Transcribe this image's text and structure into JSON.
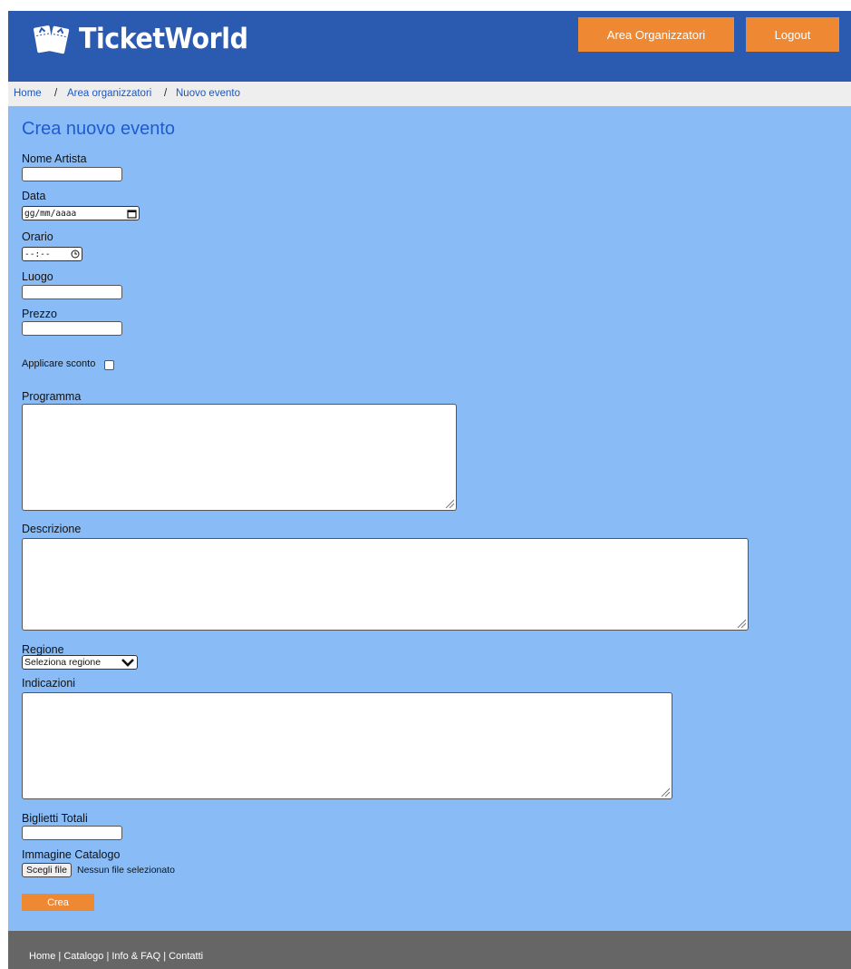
{
  "header": {
    "logo_text": "TicketWorld",
    "area_button": "Area Organizzatori",
    "logout_button": "Logout"
  },
  "breadcrumb": {
    "items": [
      "Home",
      "Area organizzatori",
      "Nuovo evento"
    ],
    "separator": "/"
  },
  "form": {
    "title": "Crea nuovo evento",
    "artist_label": "Nome Artista",
    "date_label": "Data",
    "date_placeholder": "gg/mm/aaaa",
    "time_label": "Orario",
    "time_placeholder": "--:--",
    "place_label": "Luogo",
    "price_label": "Prezzo",
    "discount_label": "Applicare sconto",
    "program_label": "Programma",
    "description_label": "Descrizione",
    "region_label": "Regione",
    "region_selected": "Seleziona regione",
    "directions_label": "Indicazioni",
    "tickets_label": "Biglietti Totali",
    "image_label": "Immagine Catalogo",
    "file_button": "Scegli file",
    "file_status": "Nessun file selezionato",
    "submit_button": "Crea"
  },
  "footer": {
    "links": [
      "Home",
      "Catalogo",
      "Info & FAQ",
      "Contatti"
    ],
    "separator": "|"
  },
  "colors": {
    "header_bg": "#2a5bb0",
    "accent_orange": "#ee8833",
    "form_bg": "#89bcf6",
    "title_blue": "#1e5bd0",
    "link_blue": "#1a56c4",
    "footer_bg": "#666666",
    "breadcrumb_bg": "#eeeeee"
  }
}
